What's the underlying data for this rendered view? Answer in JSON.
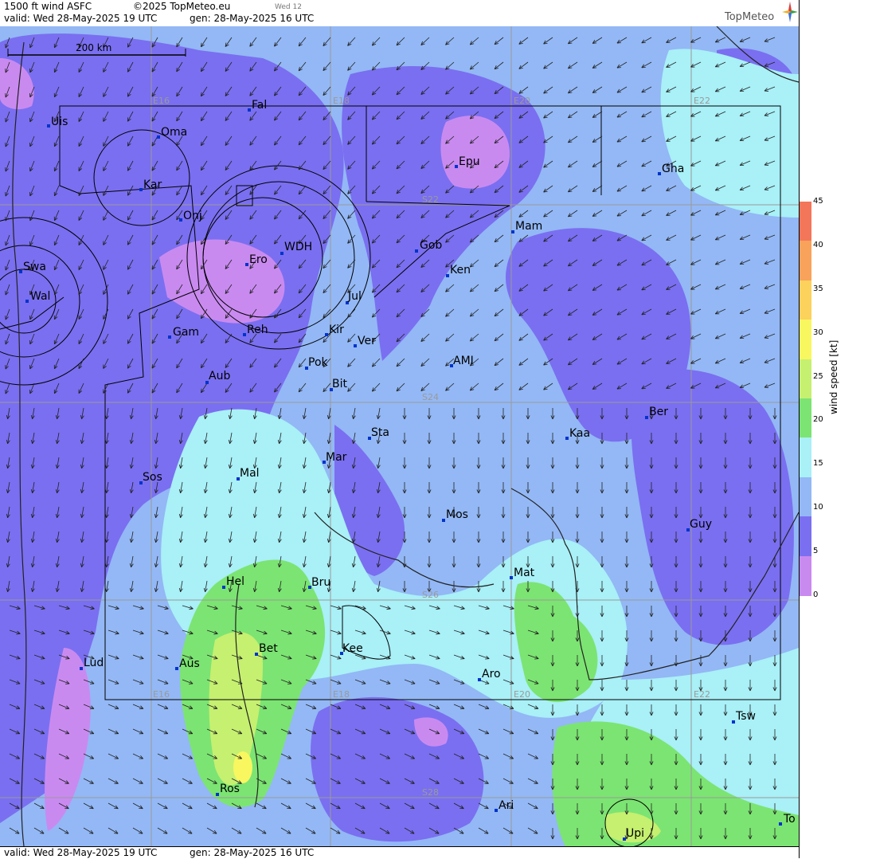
{
  "header": {
    "title": "1500 ft wind ASFC",
    "copyright": "©2025 TopMeteo.eu",
    "day_code": "Wed 12",
    "valid": "valid:  Wed  28-May-2025  19 UTC",
    "generated": "gen: 28-May-2025 16 UTC",
    "brand": "TopMeteo"
  },
  "footer": {
    "valid": "valid:  Wed  28-May-2025  19 UTC",
    "generated": "gen: 28-May-2025 16 UTC"
  },
  "scale_bar": {
    "label": "200 km"
  },
  "colorbar": {
    "label": "wind speed  [kt]",
    "ticks": [
      "45",
      "40",
      "35",
      "30",
      "25",
      "20",
      "15",
      "10",
      "5",
      "0"
    ],
    "colors": [
      "#f4765a",
      "#f9a25b",
      "#fcd15c",
      "#f8f760",
      "#c6f070",
      "#7ce472",
      "#a9f0f7",
      "#93b8f5",
      "#7a6ff0",
      "#c98af0"
    ]
  },
  "grid_labels": [
    "E16",
    "E18",
    "E20",
    "E22",
    "S22",
    "S24",
    "S26",
    "S28",
    "E16",
    "E18",
    "E20",
    "E22"
  ],
  "towns": [
    "Uis",
    "Oma",
    "Fal",
    "Kar",
    "Onj",
    "Epu",
    "Gha",
    "Mam",
    "Gob",
    "Swa",
    "Ero",
    "WDH",
    "Ken",
    "Wal",
    "Jul",
    "Gam",
    "Reh",
    "Kir",
    "Ver",
    "AMI",
    "Pok",
    "Aub",
    "Bit",
    "Ber",
    "Sta",
    "Kaa",
    "Mar",
    "Sos",
    "Mal",
    "Mos",
    "Guy",
    "Mat",
    "Hel",
    "Bru",
    "Bet",
    "Kee",
    "Lud",
    "Aus",
    "Aro",
    "Tsw",
    "Ari",
    "Ros",
    "Upi",
    "To"
  ],
  "legend_colors": {
    "calm": "#c98af0",
    "light": "#7a6ff0",
    "moderate": "#93b8f5",
    "fresh": "#a9f0f7",
    "strong": "#7ce472",
    "very_strong": "#c6f070",
    "gale": "#f8f760"
  }
}
